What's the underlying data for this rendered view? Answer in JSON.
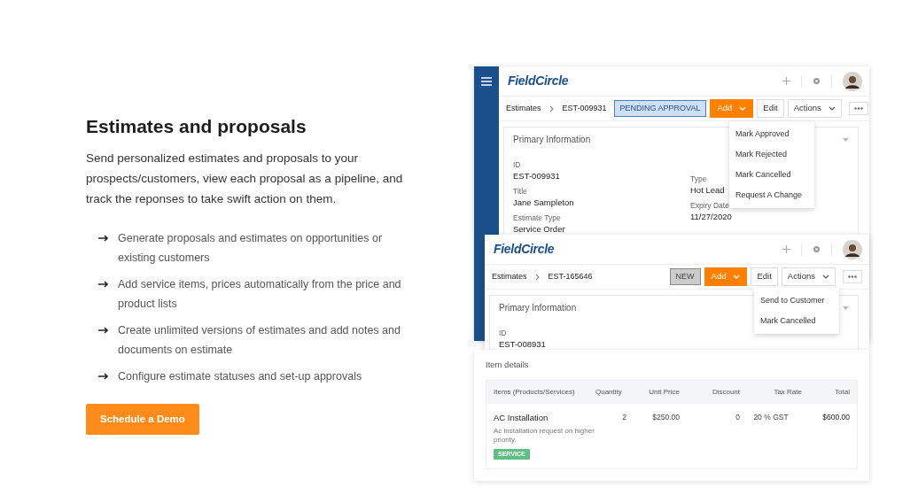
{
  "section": {
    "title": "Estimates and proposals",
    "description": "Send personalized estimates and proposals to your prospects/customers, view each proposal as a pipeline, and track the reponses to take swift action on them.",
    "features": [
      "Generate proposals and estimates on opportunities or existing customers",
      "Add service items, prices automatically from the price and product lists",
      "Create unlimited versions of estimates and add notes and documents on estimate",
      "Configure estimate statuses and set-up approvals"
    ],
    "cta": "Schedule a Demo"
  },
  "windows": [
    {
      "logo": "FieldCircle",
      "breadcrumb": {
        "root": "Estimates",
        "current": "EST-009931"
      },
      "status": {
        "label": "PENDING APPROVAL",
        "kind": "pending"
      },
      "add": "Add",
      "edit": "Edit",
      "actions": "Actions",
      "menu": [
        "Mark Approved",
        "Mark Rejected",
        "Mark Cancelled",
        "Request A Change"
      ],
      "panel": {
        "title": "Primary Information",
        "fields_left": [
          {
            "label": "ID",
            "value": "EST-009931"
          },
          {
            "label": "Title",
            "value": "Jane Sampleton"
          },
          {
            "label": "Estimate Type",
            "value": "Service Order"
          }
        ],
        "fields_right": [
          {
            "label": "Type",
            "value": "Hot Lead"
          },
          {
            "label": "Expiry Date",
            "value": "11/27/2020"
          }
        ]
      }
    },
    {
      "logo": "FieldCircle",
      "breadcrumb": {
        "root": "Estimates",
        "current": "EST-165646"
      },
      "status": {
        "label": "NEW",
        "kind": "new"
      },
      "add": "Add",
      "edit": "Edit",
      "actions": "Actions",
      "menu": [
        "Send to Customer",
        "Mark Cancelled"
      ],
      "panel": {
        "title": "Primary Information",
        "fields_left": [
          {
            "label": "ID",
            "value": "EST-008931"
          }
        ]
      }
    }
  ],
  "item_details": {
    "title": "Item details",
    "columns": [
      "Items (Products/Services)",
      "Quantity",
      "Unit Price",
      "Discount",
      "Tax Rate",
      "Total"
    ],
    "rows": [
      {
        "name": "AC Installation",
        "description": "Ac installation request on higher priority.",
        "tag": "SERVICE",
        "quantity": "2",
        "unit_price": "$250.00",
        "discount": "0",
        "tax_rate": "20 % GST",
        "total": "$600.00"
      }
    ]
  }
}
